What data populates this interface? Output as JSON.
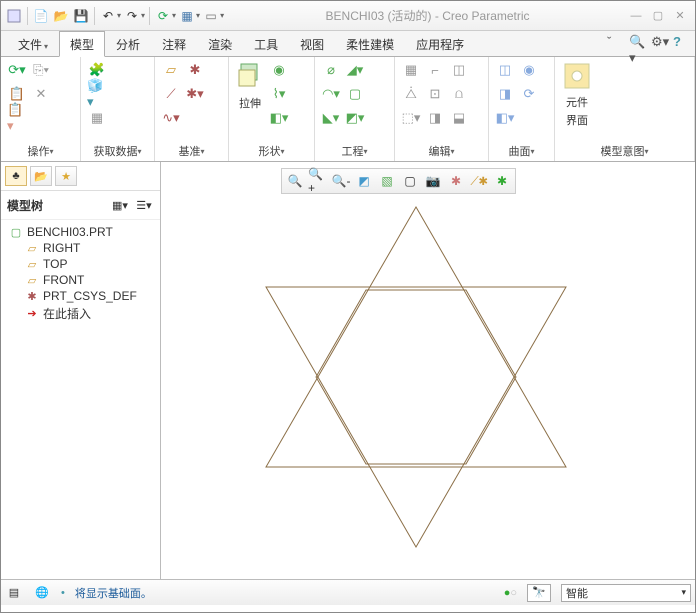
{
  "title": "BENCHI03 (活动的) - Creo Parametric",
  "qat": {
    "new": "□",
    "open": "📂",
    "save": "💾",
    "undo": "↶",
    "redo": "↷",
    "regen": "⟳",
    "windows": "▦",
    "close": "✕"
  },
  "tabs": {
    "file": "文件",
    "model": "模型",
    "analysis": "分析",
    "annotate": "注释",
    "render": "渲染",
    "tools": "工具",
    "view": "视图",
    "flex": "柔性建模",
    "app": "应用程序"
  },
  "ribbon": {
    "groups": {
      "operate": "操作",
      "getdata": "获取数据",
      "datum": "基准",
      "shape": "形状",
      "engineer": "工程",
      "edit": "编辑",
      "surface": "曲面",
      "intent": "模型意图"
    },
    "extrude": "拉伸",
    "component": "元件",
    "interface": "界面"
  },
  "tree": {
    "title": "模型树",
    "root": "BENCHI03.PRT",
    "items": [
      "RIGHT",
      "TOP",
      "FRONT",
      "PRT_CSYS_DEF",
      "在此插入"
    ]
  },
  "status": {
    "msg": "将显示基础面。",
    "filter": "智能"
  }
}
